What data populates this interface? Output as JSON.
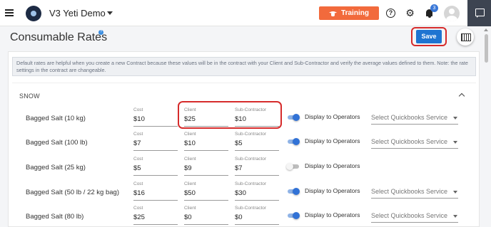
{
  "topbar": {
    "org_name": "V3 Yeti Demo",
    "training_label": "Training",
    "help_glyph": "?",
    "notification_count": "3"
  },
  "page": {
    "title": "Consumable Rates",
    "info_glyph": "?",
    "save_label": "Save",
    "note": "Default rates are helpful when you create a new Contract because these values will be in the contract with your Client and Sub-Contractor and verify the average values defined to them. Note: the rate settings in the contract are changeable."
  },
  "section": {
    "title": "SNOW",
    "labels": {
      "cost": "Cost",
      "client": "Client",
      "sub": "Sub-Contractor",
      "display": "Display to Operators",
      "quickbooks": "Select Quickbooks Service"
    },
    "items": [
      {
        "name": "Bagged Salt (10 kg)",
        "cost": "$10",
        "client": "$25",
        "sub": "$10",
        "display": true
      },
      {
        "name": "Bagged Salt (100 lb)",
        "cost": "$7",
        "client": "$10",
        "sub": "$5",
        "display": true
      },
      {
        "name": "Bagged Salt (25 kg)",
        "cost": "$5",
        "client": "$9",
        "sub": "$7",
        "display": false
      },
      {
        "name": "Bagged Salt (50 lb / 22 kg bag)",
        "cost": "$16",
        "client": "$50",
        "sub": "$30",
        "display": true
      },
      {
        "name": "Bagged Salt (80 lb)",
        "cost": "$25",
        "client": "$0",
        "sub": "$0",
        "display": true
      }
    ]
  },
  "colors": {
    "training": "#f26a3c",
    "primary": "#1f74d1",
    "highlight": "#d62b2b",
    "toggle_on": "#3172d6"
  },
  "icons": [
    "hamburger-icon",
    "org-logo",
    "chevron-down-icon",
    "graduation-cap-icon",
    "help-icon",
    "gear-icon",
    "bell-icon",
    "avatar",
    "chat-icon",
    "calculator-icon",
    "chevron-up-icon"
  ]
}
